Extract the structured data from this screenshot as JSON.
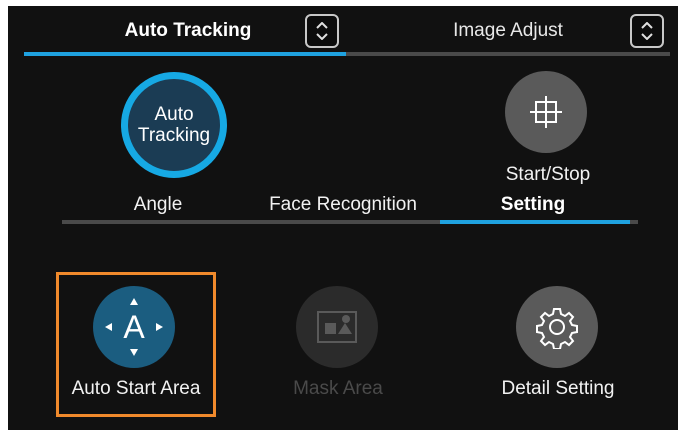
{
  "top_tabs": [
    {
      "label": "Auto Tracking",
      "active": true
    },
    {
      "label": "Image Adjust",
      "active": false
    }
  ],
  "mode": {
    "auto_tracking_label": "Auto\nTracking",
    "start_stop_label": "Start/Stop"
  },
  "sub_tabs": [
    {
      "label": "Angle",
      "active": false
    },
    {
      "label": "Face Recognition",
      "active": false
    },
    {
      "label": "Setting",
      "active": true
    }
  ],
  "settings": [
    {
      "label": "Auto Start Area",
      "icon": "auto-start-area-icon",
      "selected": true,
      "enabled": true
    },
    {
      "label": "Mask Area",
      "icon": "mask-area-icon",
      "selected": false,
      "enabled": false
    },
    {
      "label": "Detail Setting",
      "icon": "gear-icon",
      "selected": false,
      "enabled": true
    }
  ],
  "colors": {
    "accent": "#1fa2e0",
    "selection": "#f08a2c",
    "background": "#111111"
  }
}
